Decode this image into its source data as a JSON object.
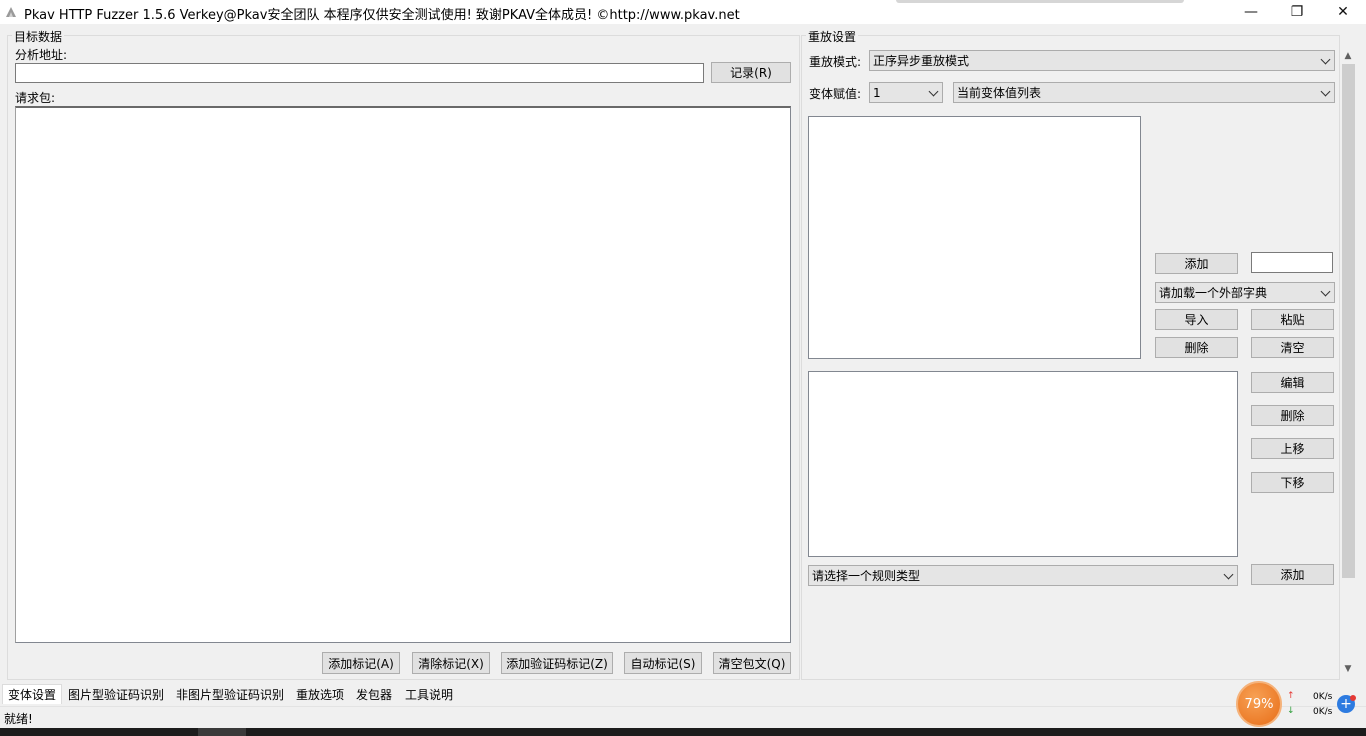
{
  "window": {
    "title": "Pkav HTTP Fuzzer 1.5.6  Verkey@Pkav安全团队  本程序仅供安全测试使用!  致谢PKAV全体成员! ©http://www.pkav.net",
    "minimize_glyph": "—",
    "maximize_glyph": "❐",
    "close_glyph": "✕"
  },
  "target": {
    "group_title": "目标数据",
    "url_label": "分析地址:",
    "url_value": "",
    "record_button": "记录(R)",
    "request_label": "请求包:",
    "request_value": "",
    "buttons": {
      "add_mark": "添加标记(A)",
      "clear_mark": "清除标记(X)",
      "add_captcha_mark": "添加验证码标记(Z)",
      "auto_mark": "自动标记(S)",
      "clear_body": "清空包文(Q)"
    }
  },
  "replay": {
    "group_title": "重放设置",
    "mode_label": "重放模式:",
    "mode_value": "正序异步重放模式",
    "var_label": "变体赋值:",
    "var_index": "1",
    "var_list": "当前变体值列表",
    "add_button": "添加",
    "add_input_value": "",
    "dict_select": "请加载一个外部字典",
    "import_button": "导入",
    "paste_button": "粘贴",
    "delete_button": "删除",
    "clear_button": "清空",
    "edit_button": "编辑",
    "rule_delete_button": "删除",
    "move_up_button": "上移",
    "move_down_button": "下移",
    "rule_select": "请选择一个规则类型",
    "rule_add_button": "添加"
  },
  "scrollbar": {
    "up": "▲",
    "down": "▼"
  },
  "tabs": [
    {
      "label": "变体设置"
    },
    {
      "label": "图片型验证码识别"
    },
    {
      "label": "非图片型验证码识别"
    },
    {
      "label": "重放选项"
    },
    {
      "label": "发包器"
    },
    {
      "label": "工具说明"
    }
  ],
  "status": {
    "text": "就绪!"
  },
  "tray": {
    "gauge": "79%",
    "up_speed": "0K/s",
    "down_speed": "0K/s",
    "up_arrow": "↑",
    "down_arrow": "↓",
    "plus": "+"
  },
  "colors": {
    "accent_orange": "#e86d17",
    "tray_blue": "#2d7be0"
  }
}
